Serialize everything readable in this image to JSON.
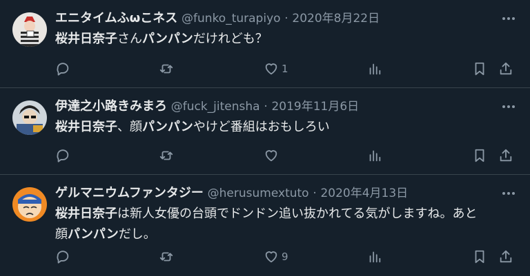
{
  "tweets": [
    {
      "name": "エニタイムふωこネス",
      "handle": "@funko_turapiyo",
      "separator": "·",
      "date": "2020年8月22日",
      "text_parts": [
        {
          "t": "桜井日奈子",
          "b": true
        },
        {
          "t": "さん",
          "b": false
        },
        {
          "t": "パンパン",
          "b": true
        },
        {
          "t": "だけれども？",
          "b": false
        }
      ],
      "likes": "1"
    },
    {
      "name": "伊達之小路きみまろ",
      "handle": "@fuck_jitensha",
      "separator": "·",
      "date": "2019年11月6日",
      "text_parts": [
        {
          "t": "桜井日奈子",
          "b": true
        },
        {
          "t": "、顔",
          "b": false
        },
        {
          "t": "パンパン",
          "b": true
        },
        {
          "t": "やけど番組はおもしろい",
          "b": false
        }
      ],
      "likes": ""
    },
    {
      "name": "ゲルマニウムファンタジー",
      "handle": "@herusumextuto",
      "separator": "·",
      "date": "2020年4月13日",
      "text_line1": [
        {
          "t": "桜井日奈子",
          "b": true
        },
        {
          "t": "は新人女優の台頭でドンドン追い抜かれてる気がしますね。あと",
          "b": false
        }
      ],
      "text_line2": [
        {
          "t": "顔",
          "b": false
        },
        {
          "t": "パンパン",
          "b": true
        },
        {
          "t": "だし。",
          "b": false
        }
      ],
      "likes": "9"
    }
  ],
  "icons": {
    "reply": "reply-icon",
    "retweet": "retweet-icon",
    "like": "heart-icon",
    "views": "views-icon",
    "bookmark": "bookmark-icon",
    "share": "share-icon",
    "more": "more-icon"
  },
  "colors": {
    "background": "#15202b",
    "text": "#e7e9ea",
    "muted": "#8b98a5",
    "divider": "#38444d"
  }
}
